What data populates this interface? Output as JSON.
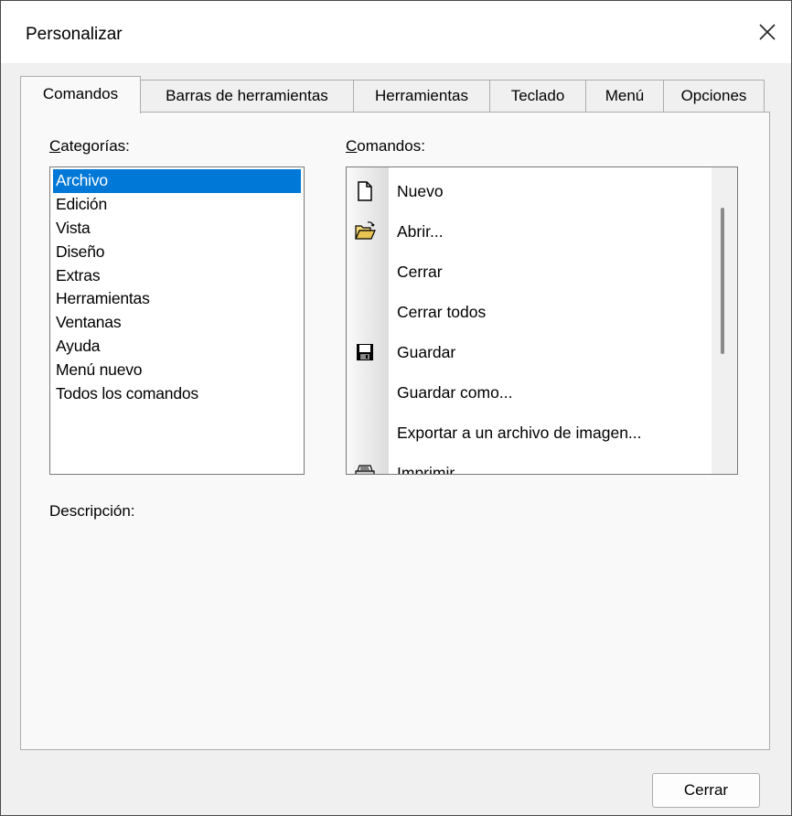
{
  "window": {
    "title": "Personalizar"
  },
  "tabs": [
    {
      "label": "Comandos",
      "active": true
    },
    {
      "label": "Barras de herramientas"
    },
    {
      "label": "Herramientas"
    },
    {
      "label": "Teclado"
    },
    {
      "label": "Menú"
    },
    {
      "label": "Opciones"
    }
  ],
  "categories": {
    "label_first": "C",
    "label_rest": "ategorías:",
    "selected": "Archivo",
    "items": [
      "Archivo",
      "Edición",
      "Vista",
      "Diseño",
      "Extras",
      "Herramientas",
      "Ventanas",
      "Ayuda",
      "Menú nuevo",
      "Todos los comandos"
    ]
  },
  "commands": {
    "label_first": "C",
    "label_rest": "omandos:",
    "items": [
      {
        "label": "Nuevo",
        "icon": "new-document-icon"
      },
      {
        "label": "Abrir...",
        "icon": "open-folder-icon"
      },
      {
        "label": "Cerrar",
        "icon": ""
      },
      {
        "label": "Cerrar todos",
        "icon": ""
      },
      {
        "label": "Guardar",
        "icon": "save-disk-icon"
      },
      {
        "label": "Guardar como...",
        "icon": ""
      },
      {
        "label": "Exportar a un archivo de imagen...",
        "icon": ""
      },
      {
        "label": "Imprimir",
        "icon": "print-icon"
      }
    ]
  },
  "description": {
    "label": "Descripción:"
  },
  "footer": {
    "close_label": "Cerrar"
  },
  "colors": {
    "selection": "#0078d7"
  }
}
